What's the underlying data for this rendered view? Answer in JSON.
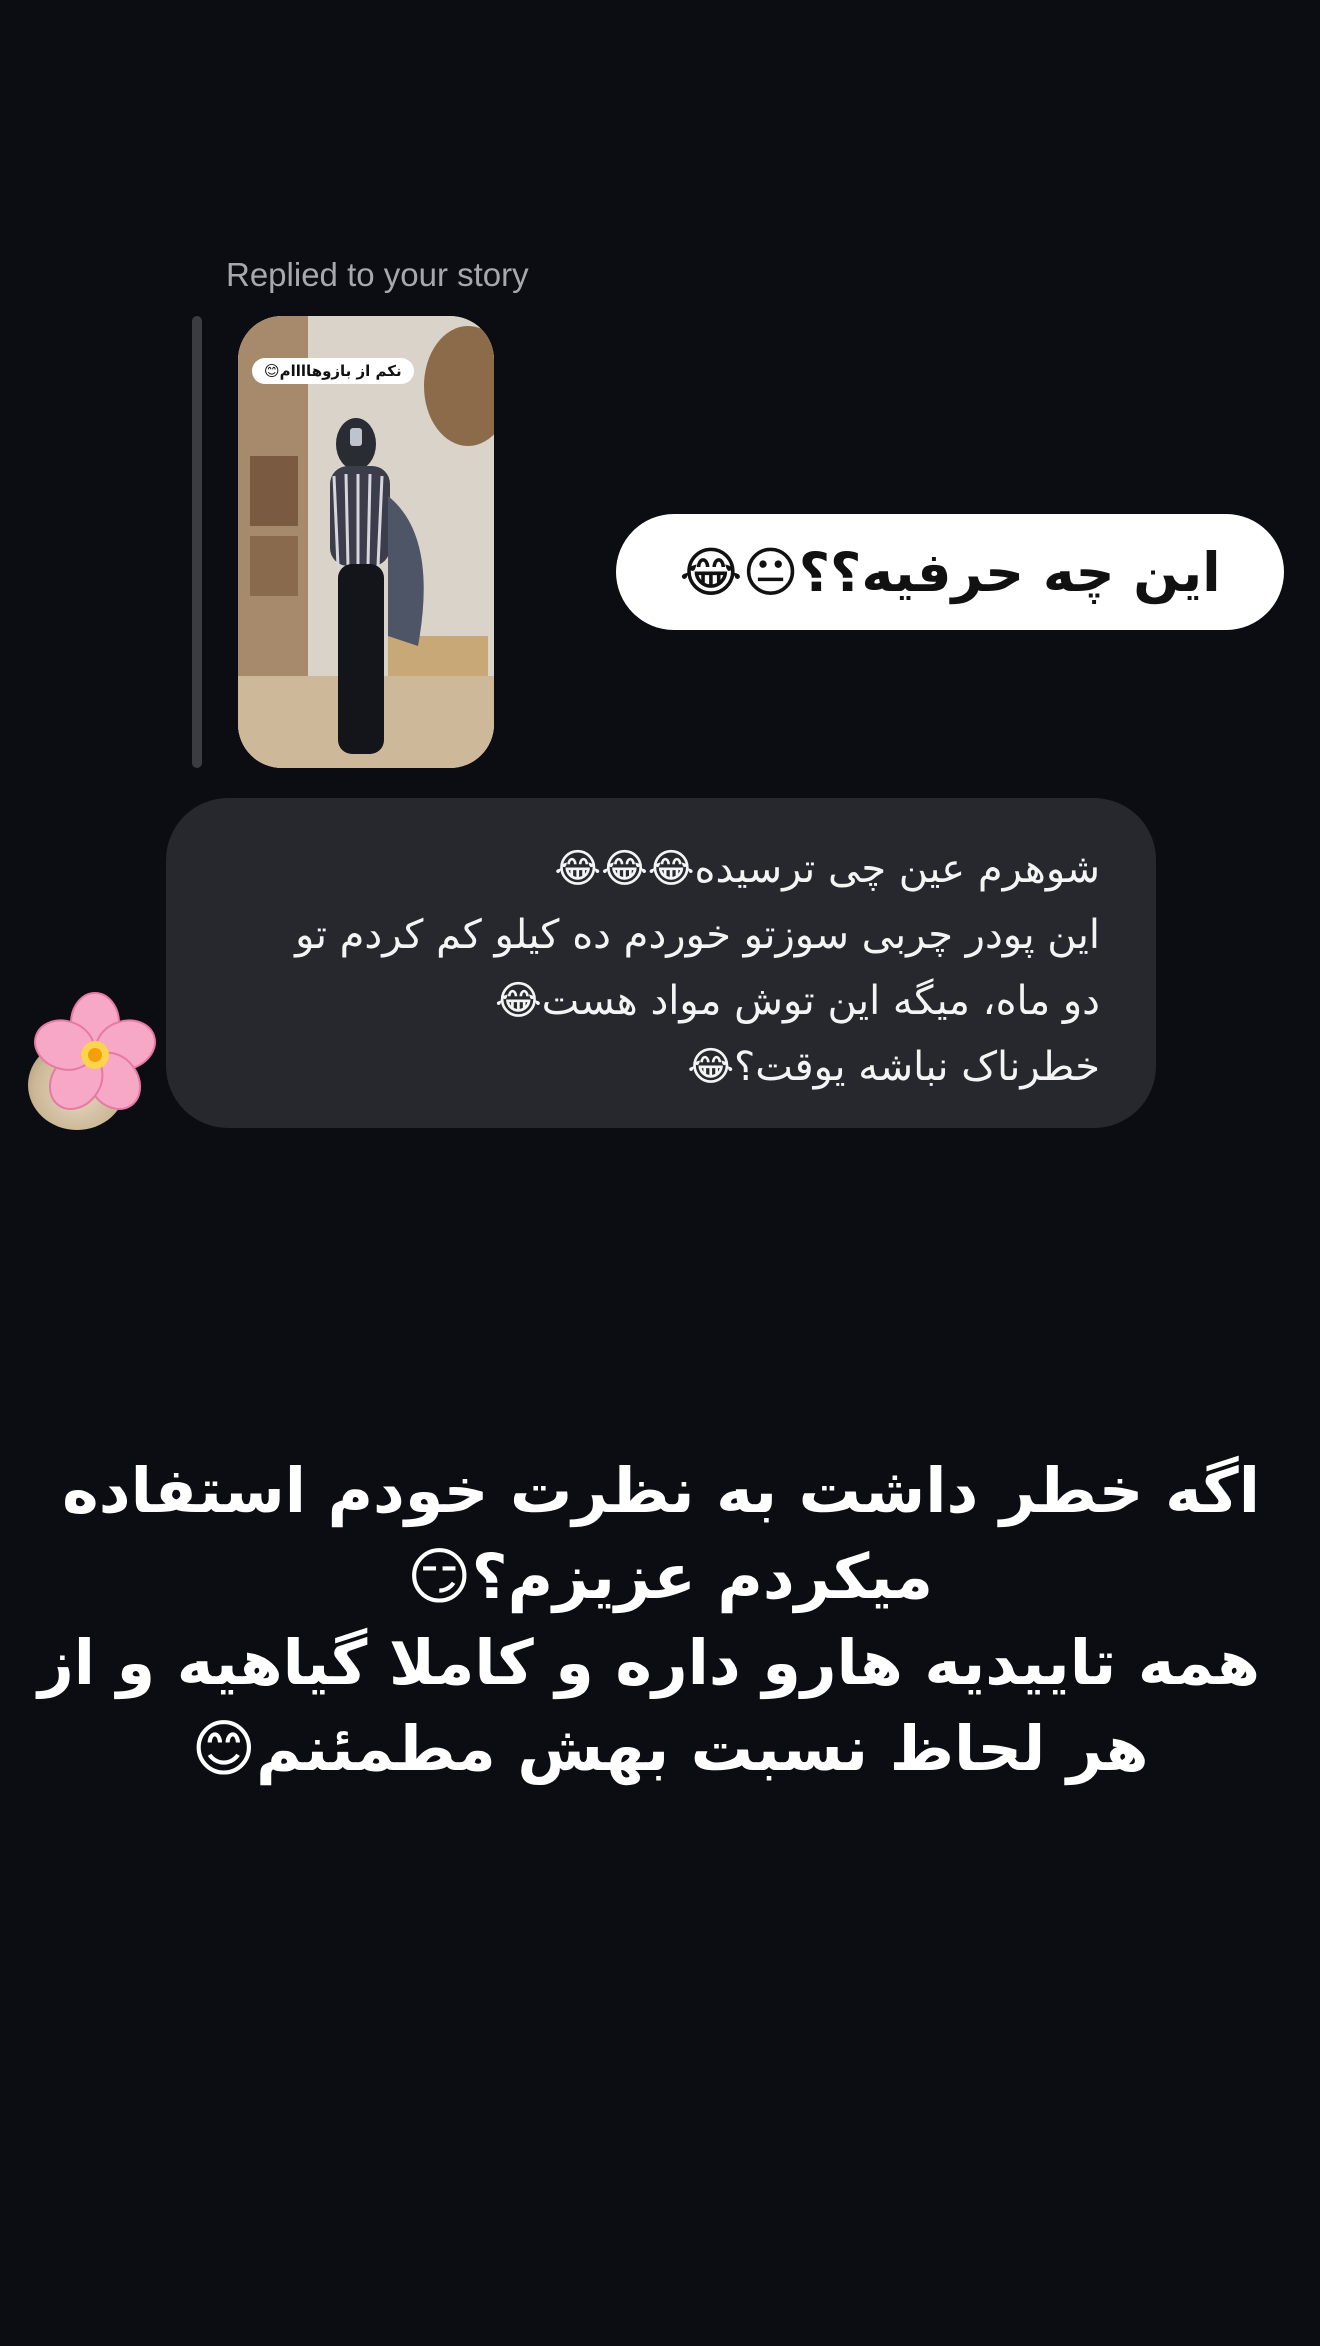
{
  "reply_caption": "Replied to your story",
  "story": {
    "sticker_text": "نکم از بازوهاااام😊"
  },
  "sent_message": "این چه حرفیه؟؟😐😂",
  "incoming_message": {
    "lines": [
      "شوهرم عین چی ترسیده😂😂😂",
      "این  پودر چربی سوزتو خوردم ده کیلو کم کردم تو",
      "دو ماه، میگه این توش مواد هست😂",
      "خطرناک نباشه یوقت؟😂"
    ]
  },
  "overlay": {
    "lines": [
      "اگه خطر داشت به نظرت خودم استفاده",
      "میکردم عزیزم؟😏",
      "همه تاییدیه هارو داره و کاملا گیاهیه و از",
      "هر لحاظ نسبت بهش مطمئنم😊"
    ]
  },
  "colors": {
    "background": "#0b0d12",
    "incoming_bubble": "#26282d",
    "sent_bubble": "#ffffff",
    "caption": "#a6a8ad"
  },
  "icons": {
    "avatar_sticker": "cherry-blossom-icon"
  }
}
